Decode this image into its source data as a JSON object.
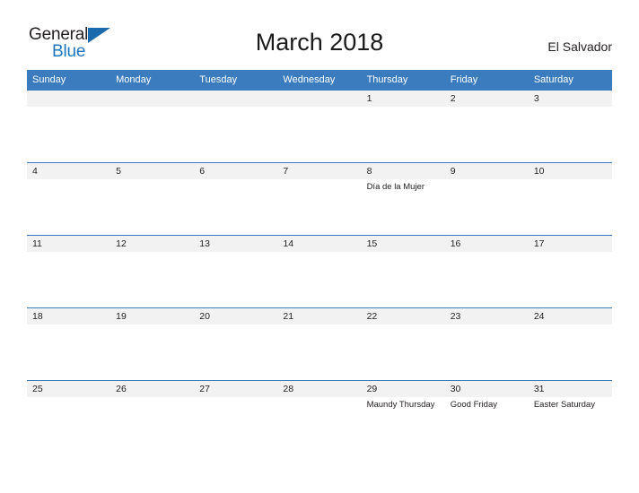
{
  "brand": {
    "name_part1": "General",
    "name_part2": "Blue",
    "triangle_color": "#1a6aad",
    "blue_text_color": "#1f76bd"
  },
  "header": {
    "title": "March 2018",
    "location": "El Salvador"
  },
  "theme": {
    "header_blue": "#3b7cbf",
    "date_band_gray": "#f2f2f2",
    "row_rule_blue": "#3b7cbf",
    "text_color": "#231f20"
  },
  "calendar": {
    "weekday_headers": [
      "Sunday",
      "Monday",
      "Tuesday",
      "Wednesday",
      "Thursday",
      "Friday",
      "Saturday"
    ],
    "weeks": [
      [
        {
          "date": "",
          "event": ""
        },
        {
          "date": "",
          "event": ""
        },
        {
          "date": "",
          "event": ""
        },
        {
          "date": "",
          "event": ""
        },
        {
          "date": "1",
          "event": ""
        },
        {
          "date": "2",
          "event": ""
        },
        {
          "date": "3",
          "event": ""
        }
      ],
      [
        {
          "date": "4",
          "event": ""
        },
        {
          "date": "5",
          "event": ""
        },
        {
          "date": "6",
          "event": ""
        },
        {
          "date": "7",
          "event": ""
        },
        {
          "date": "8",
          "event": "Día de la Mujer"
        },
        {
          "date": "9",
          "event": ""
        },
        {
          "date": "10",
          "event": ""
        }
      ],
      [
        {
          "date": "11",
          "event": ""
        },
        {
          "date": "12",
          "event": ""
        },
        {
          "date": "13",
          "event": ""
        },
        {
          "date": "14",
          "event": ""
        },
        {
          "date": "15",
          "event": ""
        },
        {
          "date": "16",
          "event": ""
        },
        {
          "date": "17",
          "event": ""
        }
      ],
      [
        {
          "date": "18",
          "event": ""
        },
        {
          "date": "19",
          "event": ""
        },
        {
          "date": "20",
          "event": ""
        },
        {
          "date": "21",
          "event": ""
        },
        {
          "date": "22",
          "event": ""
        },
        {
          "date": "23",
          "event": ""
        },
        {
          "date": "24",
          "event": ""
        }
      ],
      [
        {
          "date": "25",
          "event": ""
        },
        {
          "date": "26",
          "event": ""
        },
        {
          "date": "27",
          "event": ""
        },
        {
          "date": "28",
          "event": ""
        },
        {
          "date": "29",
          "event": "Maundy Thursday"
        },
        {
          "date": "30",
          "event": "Good Friday"
        },
        {
          "date": "31",
          "event": "Easter Saturday"
        }
      ]
    ]
  }
}
